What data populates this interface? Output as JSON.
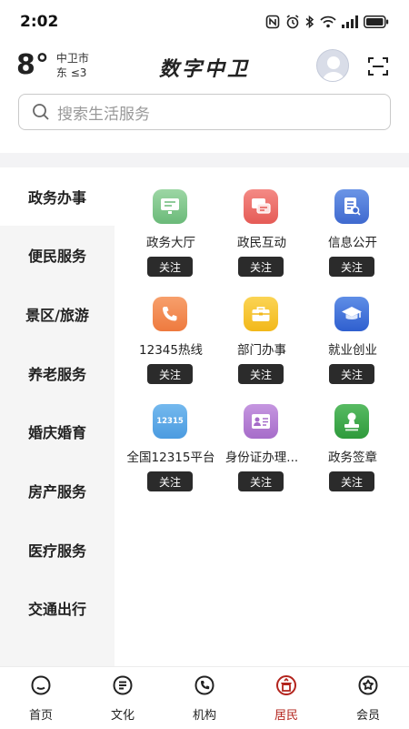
{
  "status_bar": {
    "time": "2:02",
    "icons": [
      "nfc-icon",
      "alarm-icon",
      "bluetooth-icon",
      "wifi-icon",
      "signal-icon",
      "battery-icon"
    ]
  },
  "header": {
    "temperature": "8°",
    "city": "中卫市",
    "wind": "东 ≤3",
    "title": "数字中卫",
    "avatar_icon": "user-avatar-icon",
    "scan_icon": "scan-icon"
  },
  "search": {
    "placeholder": "搜索生活服务",
    "icon": "search-icon"
  },
  "sidebar": {
    "active_index": 0,
    "items": [
      {
        "label": "政务办事"
      },
      {
        "label": "便民服务"
      },
      {
        "label": "景区/旅游"
      },
      {
        "label": "养老服务"
      },
      {
        "label": "婚庆婚育"
      },
      {
        "label": "房产服务"
      },
      {
        "label": "医疗服务"
      },
      {
        "label": "交通出行"
      }
    ]
  },
  "services": [
    {
      "label": "政务大厅",
      "follow": "关注",
      "icon": "monitor-icon",
      "color": "#7cc48a"
    },
    {
      "label": "政民互动",
      "follow": "关注",
      "icon": "chat-icon",
      "color": "#ee6b66"
    },
    {
      "label": "信息公开",
      "follow": "关注",
      "icon": "document-search-icon",
      "color": "#4a78d8"
    },
    {
      "label": "12345热线",
      "follow": "关注",
      "icon": "phone-icon",
      "color": "#f0884f"
    },
    {
      "label": "部门办事",
      "follow": "关注",
      "icon": "briefcase-icon",
      "color": "#f5c230"
    },
    {
      "label": "就业创业",
      "follow": "关注",
      "icon": "graduation-cap-icon",
      "color": "#3d6fd9"
    },
    {
      "label": "全国12315平台",
      "follow": "关注",
      "icon": "badge-12315-icon",
      "color": "#58a8e8",
      "icon_text": "12315"
    },
    {
      "label": "身份证办理...",
      "follow": "关注",
      "icon": "id-card-icon",
      "color": "#b27fd4"
    },
    {
      "label": "政务签章",
      "follow": "关注",
      "icon": "stamp-icon",
      "color": "#3ea84a"
    }
  ],
  "bottom_nav": {
    "active_index": 3,
    "accent": "#b3241d",
    "items": [
      {
        "label": "首页",
        "icon": "home-icon"
      },
      {
        "label": "文化",
        "icon": "culture-icon"
      },
      {
        "label": "机构",
        "icon": "institution-icon"
      },
      {
        "label": "居民",
        "icon": "resident-icon"
      },
      {
        "label": "会员",
        "icon": "member-icon"
      }
    ]
  }
}
